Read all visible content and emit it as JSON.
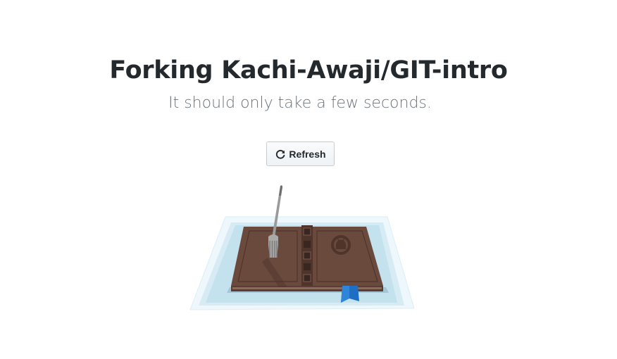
{
  "page": {
    "title": "Forking Kachi-Awaji/GIT-intro",
    "subtitle": "It should only take a few seconds."
  },
  "actions": {
    "refresh_label": "Refresh",
    "refresh_icon": "sync-icon"
  },
  "illustration": {
    "description_icon": "fork-book-illustration"
  },
  "colors": {
    "title": "#24292e",
    "subtitle": "#6a737d",
    "book": "#6b4a3e",
    "tray": "#c8e3ef",
    "bookmark": "#1e6fc3"
  }
}
